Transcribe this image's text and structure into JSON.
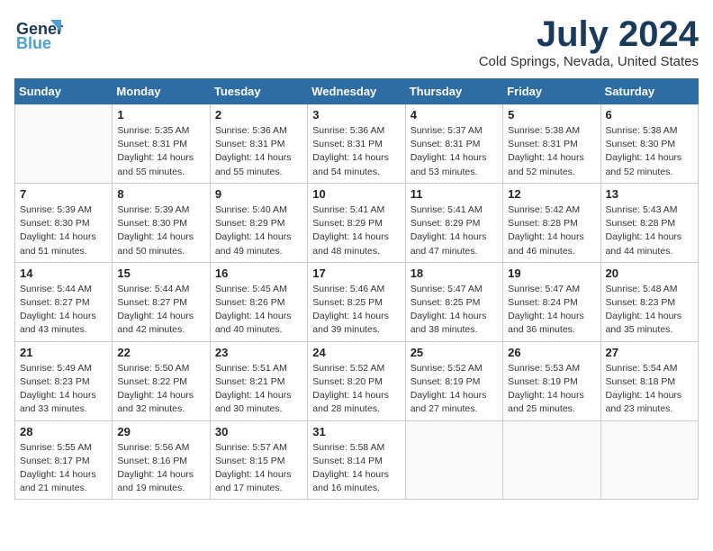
{
  "header": {
    "logo_line1": "General",
    "logo_line2": "Blue",
    "month_year": "July 2024",
    "location": "Cold Springs, Nevada, United States"
  },
  "days_of_week": [
    "Sunday",
    "Monday",
    "Tuesday",
    "Wednesday",
    "Thursday",
    "Friday",
    "Saturday"
  ],
  "weeks": [
    [
      {
        "day": "",
        "info": ""
      },
      {
        "day": "1",
        "info": "Sunrise: 5:35 AM\nSunset: 8:31 PM\nDaylight: 14 hours\nand 55 minutes."
      },
      {
        "day": "2",
        "info": "Sunrise: 5:36 AM\nSunset: 8:31 PM\nDaylight: 14 hours\nand 55 minutes."
      },
      {
        "day": "3",
        "info": "Sunrise: 5:36 AM\nSunset: 8:31 PM\nDaylight: 14 hours\nand 54 minutes."
      },
      {
        "day": "4",
        "info": "Sunrise: 5:37 AM\nSunset: 8:31 PM\nDaylight: 14 hours\nand 53 minutes."
      },
      {
        "day": "5",
        "info": "Sunrise: 5:38 AM\nSunset: 8:31 PM\nDaylight: 14 hours\nand 52 minutes."
      },
      {
        "day": "6",
        "info": "Sunrise: 5:38 AM\nSunset: 8:30 PM\nDaylight: 14 hours\nand 52 minutes."
      }
    ],
    [
      {
        "day": "7",
        "info": "Sunrise: 5:39 AM\nSunset: 8:30 PM\nDaylight: 14 hours\nand 51 minutes."
      },
      {
        "day": "8",
        "info": "Sunrise: 5:39 AM\nSunset: 8:30 PM\nDaylight: 14 hours\nand 50 minutes."
      },
      {
        "day": "9",
        "info": "Sunrise: 5:40 AM\nSunset: 8:29 PM\nDaylight: 14 hours\nand 49 minutes."
      },
      {
        "day": "10",
        "info": "Sunrise: 5:41 AM\nSunset: 8:29 PM\nDaylight: 14 hours\nand 48 minutes."
      },
      {
        "day": "11",
        "info": "Sunrise: 5:41 AM\nSunset: 8:29 PM\nDaylight: 14 hours\nand 47 minutes."
      },
      {
        "day": "12",
        "info": "Sunrise: 5:42 AM\nSunset: 8:28 PM\nDaylight: 14 hours\nand 46 minutes."
      },
      {
        "day": "13",
        "info": "Sunrise: 5:43 AM\nSunset: 8:28 PM\nDaylight: 14 hours\nand 44 minutes."
      }
    ],
    [
      {
        "day": "14",
        "info": "Sunrise: 5:44 AM\nSunset: 8:27 PM\nDaylight: 14 hours\nand 43 minutes."
      },
      {
        "day": "15",
        "info": "Sunrise: 5:44 AM\nSunset: 8:27 PM\nDaylight: 14 hours\nand 42 minutes."
      },
      {
        "day": "16",
        "info": "Sunrise: 5:45 AM\nSunset: 8:26 PM\nDaylight: 14 hours\nand 40 minutes."
      },
      {
        "day": "17",
        "info": "Sunrise: 5:46 AM\nSunset: 8:25 PM\nDaylight: 14 hours\nand 39 minutes."
      },
      {
        "day": "18",
        "info": "Sunrise: 5:47 AM\nSunset: 8:25 PM\nDaylight: 14 hours\nand 38 minutes."
      },
      {
        "day": "19",
        "info": "Sunrise: 5:47 AM\nSunset: 8:24 PM\nDaylight: 14 hours\nand 36 minutes."
      },
      {
        "day": "20",
        "info": "Sunrise: 5:48 AM\nSunset: 8:23 PM\nDaylight: 14 hours\nand 35 minutes."
      }
    ],
    [
      {
        "day": "21",
        "info": "Sunrise: 5:49 AM\nSunset: 8:23 PM\nDaylight: 14 hours\nand 33 minutes."
      },
      {
        "day": "22",
        "info": "Sunrise: 5:50 AM\nSunset: 8:22 PM\nDaylight: 14 hours\nand 32 minutes."
      },
      {
        "day": "23",
        "info": "Sunrise: 5:51 AM\nSunset: 8:21 PM\nDaylight: 14 hours\nand 30 minutes."
      },
      {
        "day": "24",
        "info": "Sunrise: 5:52 AM\nSunset: 8:20 PM\nDaylight: 14 hours\nand 28 minutes."
      },
      {
        "day": "25",
        "info": "Sunrise: 5:52 AM\nSunset: 8:19 PM\nDaylight: 14 hours\nand 27 minutes."
      },
      {
        "day": "26",
        "info": "Sunrise: 5:53 AM\nSunset: 8:19 PM\nDaylight: 14 hours\nand 25 minutes."
      },
      {
        "day": "27",
        "info": "Sunrise: 5:54 AM\nSunset: 8:18 PM\nDaylight: 14 hours\nand 23 minutes."
      }
    ],
    [
      {
        "day": "28",
        "info": "Sunrise: 5:55 AM\nSunset: 8:17 PM\nDaylight: 14 hours\nand 21 minutes."
      },
      {
        "day": "29",
        "info": "Sunrise: 5:56 AM\nSunset: 8:16 PM\nDaylight: 14 hours\nand 19 minutes."
      },
      {
        "day": "30",
        "info": "Sunrise: 5:57 AM\nSunset: 8:15 PM\nDaylight: 14 hours\nand 17 minutes."
      },
      {
        "day": "31",
        "info": "Sunrise: 5:58 AM\nSunset: 8:14 PM\nDaylight: 14 hours\nand 16 minutes."
      },
      {
        "day": "",
        "info": ""
      },
      {
        "day": "",
        "info": ""
      },
      {
        "day": "",
        "info": ""
      }
    ]
  ]
}
